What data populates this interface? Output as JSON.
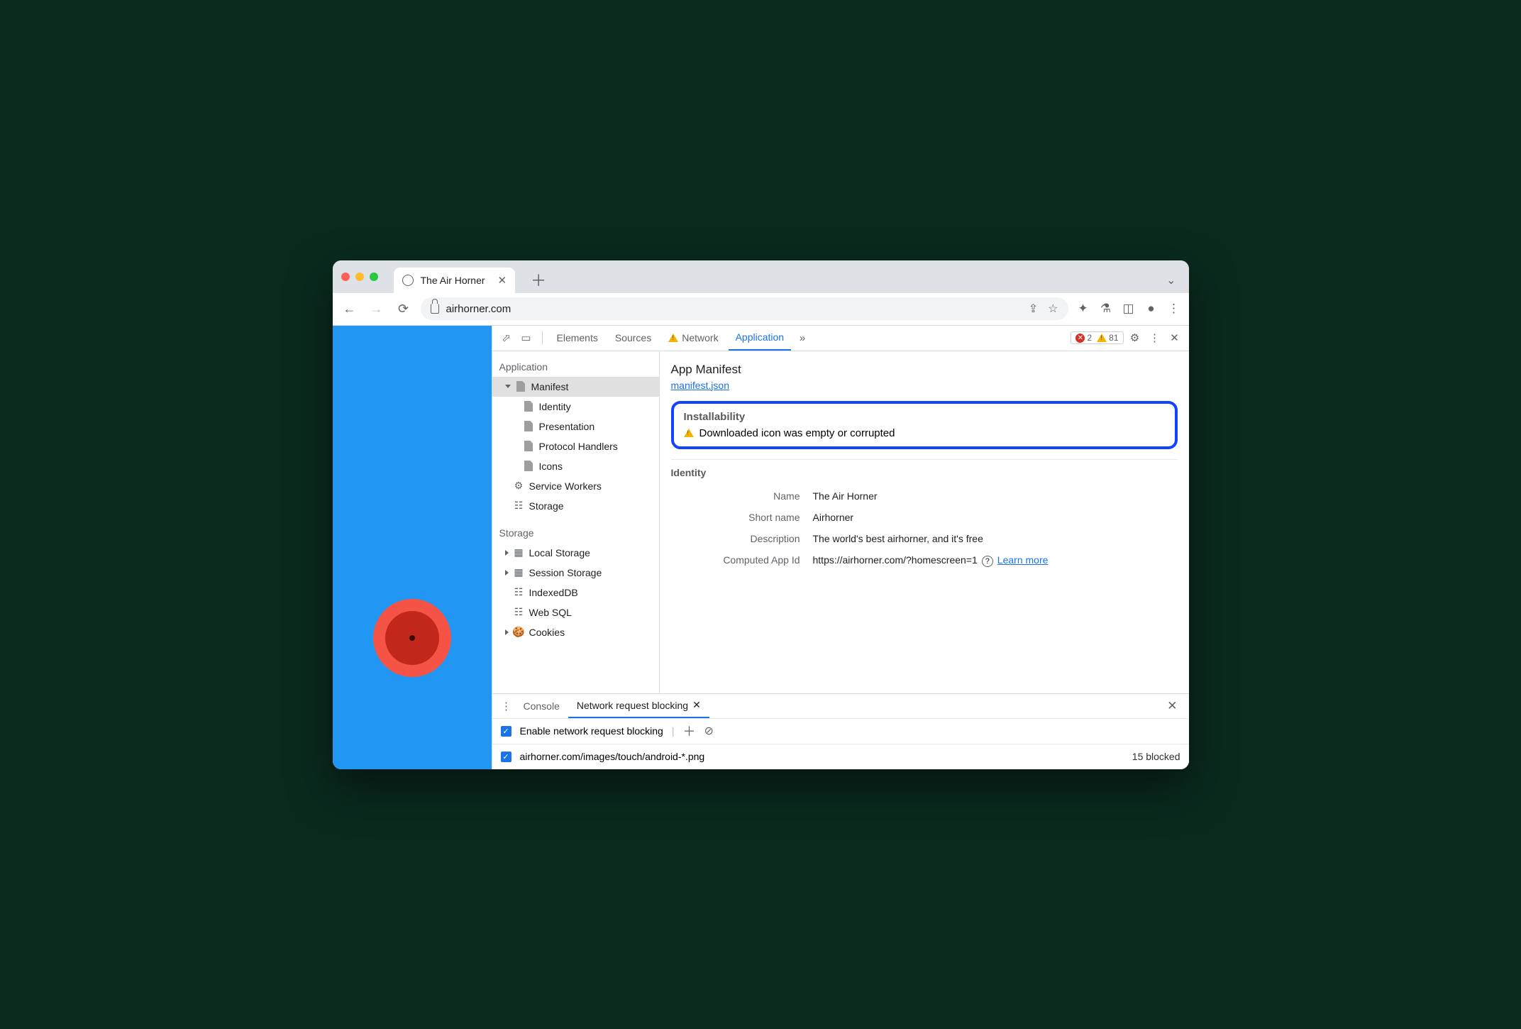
{
  "browser": {
    "tab_title": "The Air Horner",
    "url": "airhorner.com"
  },
  "devtools": {
    "tabs": {
      "elements": "Elements",
      "sources": "Sources",
      "network": "Network",
      "application": "Application"
    },
    "errors": 2,
    "warnings": 81,
    "sidebar": {
      "app_head": "Application",
      "manifest": "Manifest",
      "identity": "Identity",
      "presentation": "Presentation",
      "protocol": "Protocol Handlers",
      "icons": "Icons",
      "service_workers": "Service Workers",
      "storage": "Storage",
      "storage_head": "Storage",
      "local": "Local Storage",
      "session": "Session Storage",
      "indexed": "IndexedDB",
      "websql": "Web SQL",
      "cookies": "Cookies"
    },
    "manifest": {
      "title": "App Manifest",
      "file": "manifest.json",
      "install_head": "Installability",
      "install_msg": "Downloaded icon was empty or corrupted",
      "identity_head": "Identity",
      "name_k": "Name",
      "name_v": "The Air Horner",
      "short_k": "Short name",
      "short_v": "Airhorner",
      "desc_k": "Description",
      "desc_v": "The world's best airhorner, and it's free",
      "appid_k": "Computed App Id",
      "appid_v": "https://airhorner.com/?homescreen=1",
      "learn": "Learn more"
    },
    "drawer": {
      "console": "Console",
      "nrb": "Network request blocking",
      "enable": "Enable network request blocking",
      "pattern": "airhorner.com/images/touch/android-*.png",
      "blocked": "15 blocked"
    }
  }
}
